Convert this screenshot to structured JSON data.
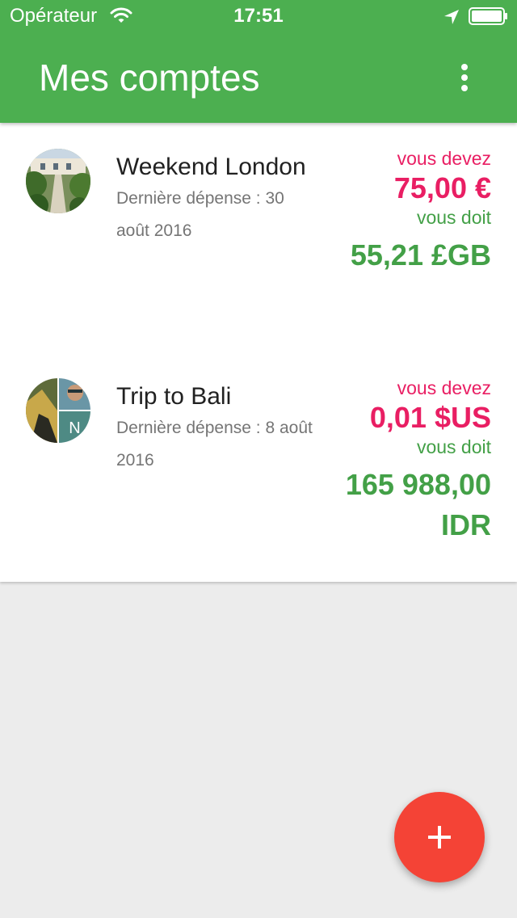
{
  "status_bar": {
    "carrier": "Opérateur",
    "time": "17:51",
    "icons": [
      "wifi-icon",
      "location-arrow-icon",
      "battery-icon"
    ]
  },
  "app_bar": {
    "title": "Mes comptes",
    "menu_icon": "more-vert-icon",
    "color": "#4caf50"
  },
  "accounts": [
    {
      "name": "Weekend London",
      "last_expense": "Dernière dépense : 30 août 2016",
      "owe_label": "vous devez",
      "owe_amount": "75,00 €",
      "owed_label": "vous doit",
      "owed_amount": "55,21 £GB"
    },
    {
      "name": "Trip to Bali",
      "last_expense": "Dernière dépense : 8 août 2016",
      "avatar_initial": "N",
      "owe_label": "vous devez",
      "owe_amount": "0,01 $US",
      "owed_label": "vous doit",
      "owed_amount": "165 988,00 IDR"
    }
  ],
  "fab": {
    "icon": "plus-icon",
    "color": "#f44336"
  },
  "colors": {
    "owe": "#e91e63",
    "owed": "#43a047"
  }
}
